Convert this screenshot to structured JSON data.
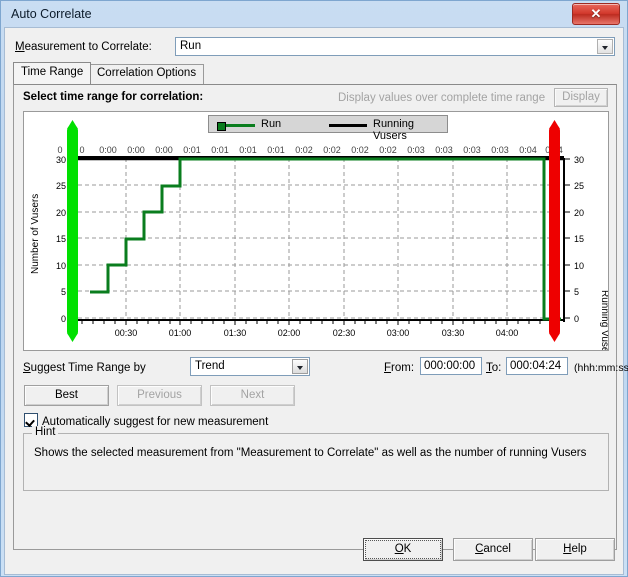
{
  "window": {
    "title": "Auto Correlate",
    "close_icon": "close-icon",
    "close_label": "✕"
  },
  "measurement": {
    "label": "Measurement to Correlate:",
    "label_accel": "M",
    "value": "Run",
    "options": [
      "Run"
    ]
  },
  "tabs": [
    {
      "id": "time-range",
      "label": "Time Range",
      "active": true
    },
    {
      "id": "correlation-options",
      "label": "Correlation Options",
      "active": false
    }
  ],
  "panel": {
    "title": "Select time range for correlation:",
    "disabled_note": "Display values over complete time range",
    "display_button": "Display"
  },
  "legend": {
    "items": [
      {
        "label": "Run",
        "color": "#0a7d1e"
      },
      {
        "label": "Running Vusers",
        "color": "#000000"
      }
    ]
  },
  "suggest": {
    "label": "Suggest Time Range by",
    "label_accel": "S",
    "value": "Trend",
    "options": [
      "Trend"
    ],
    "best_button": "Best",
    "previous_button": "Previous",
    "next_button": "Next"
  },
  "range": {
    "from_label": "From:",
    "from_value": "000:00:00",
    "to_label": "To:",
    "to_value": "000:04:24",
    "format_label": "(hhh:mm:ss)"
  },
  "auto_suggest": {
    "label": "Automatically suggest for new measurement",
    "checked": true
  },
  "hint": {
    "title": "Hint",
    "text": "Shows the selected measurement from \"Measurement to Correlate\" as well as the number of running Vusers"
  },
  "footer": {
    "ok": "OK",
    "cancel": "Cancel",
    "help": "Help"
  },
  "colors": {
    "run_series": "#0a7d1e",
    "vusers_series": "#000000",
    "left_marker": "#00e000",
    "right_marker": "#ee0000",
    "grid": "#9a9a9a",
    "plot_bg": "#ffffff"
  },
  "chart_data": {
    "type": "line",
    "title": "",
    "xlabel": "",
    "ylabel": "Number of Vusers",
    "y2label": "Running Vusers",
    "ylim": [
      0,
      32
    ],
    "y2lim": [
      0,
      32
    ],
    "yticks": [
      0,
      5,
      10,
      15,
      20,
      25,
      30
    ],
    "y2ticks": [
      0,
      5,
      10,
      15,
      20,
      25,
      30
    ],
    "xlim_seconds": [
      0,
      264
    ],
    "xtick_labels_bottom": [
      "00:30",
      "01:00",
      "01:30",
      "02:00",
      "02:30",
      "03:00",
      "03:30",
      "04:00"
    ],
    "xtick_seconds_bottom": [
      30,
      60,
      90,
      120,
      150,
      180,
      210,
      240
    ],
    "xtick_labels_top": [
      "0",
      "0",
      "0:00",
      "0:00",
      "0:00",
      "0:01",
      "0:01",
      "0:01",
      "0:01",
      "0:02",
      "0:02",
      "0:02",
      "0:02",
      "0:03",
      "0:03",
      "0:03",
      "0:03",
      "0:04",
      "0:04"
    ],
    "grid": true,
    "legend_position": "top-center",
    "series": [
      {
        "name": "Running Vusers",
        "color": "#000000",
        "step": "post",
        "x": [
          0,
          264
        ],
        "values": [
          30,
          30
        ]
      },
      {
        "name": "Run",
        "color": "#0a7d1e",
        "step": "post",
        "x": [
          0,
          18,
          36,
          54,
          72,
          90,
          255,
          264
        ],
        "values": [
          5,
          10,
          15,
          20,
          25,
          30,
          30,
          0
        ]
      }
    ],
    "markers": [
      {
        "name": "range-start",
        "color": "#00e000",
        "seconds": 0
      },
      {
        "name": "range-end",
        "color": "#ee0000",
        "seconds": 264
      }
    ]
  }
}
